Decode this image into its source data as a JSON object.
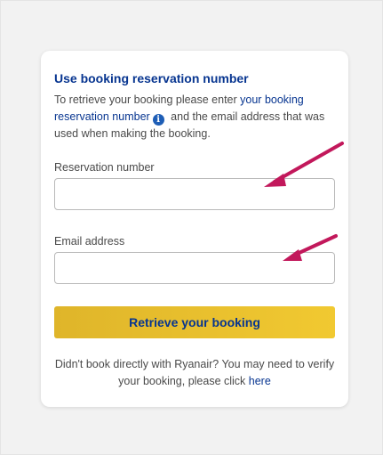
{
  "colors": {
    "brand_blue": "#073590",
    "button_yellow": "#f1c931",
    "info_icon_blue": "#1e5eb6",
    "annotation_arrow": "#c2185b"
  },
  "card": {
    "title": "Use booking reservation number",
    "intro_before": "To retrieve your booking please enter ",
    "intro_link": "your booking reservation number",
    "info_icon_glyph": "i",
    "intro_after": " and the email address that was used when making the booking."
  },
  "reservation": {
    "label": "Reservation number",
    "value": "",
    "placeholder": ""
  },
  "email": {
    "label": "Email address",
    "value": "",
    "placeholder": ""
  },
  "submit": {
    "label": "Retrieve your booking"
  },
  "footer": {
    "text": "Didn't book directly with Ryanair? You may need to verify your booking, please click ",
    "link": "here"
  },
  "annotations": {
    "arrow_icon": "arrow-icon"
  }
}
